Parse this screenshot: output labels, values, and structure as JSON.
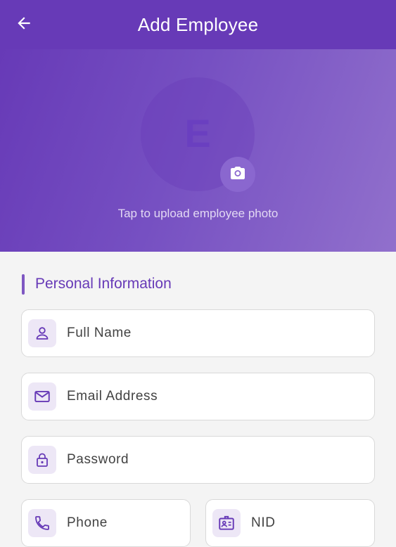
{
  "appbar": {
    "title": "Add Employee",
    "back_icon": "arrow-left-icon",
    "color": "#673ab7"
  },
  "photo": {
    "initial": "E",
    "camera_icon": "camera-icon",
    "hint": "Tap to upload employee photo"
  },
  "section": {
    "title": "Personal Information",
    "accent_color": "#7e57c2"
  },
  "fields": {
    "full_name": {
      "placeholder": "Full Name",
      "icon": "person-icon"
    },
    "email": {
      "placeholder": "Email Address",
      "icon": "mail-icon"
    },
    "password": {
      "placeholder": "Password",
      "icon": "lock-icon"
    },
    "phone": {
      "placeholder": "Phone",
      "icon": "phone-icon"
    },
    "nid": {
      "placeholder": "NID",
      "icon": "id-card-icon"
    }
  }
}
